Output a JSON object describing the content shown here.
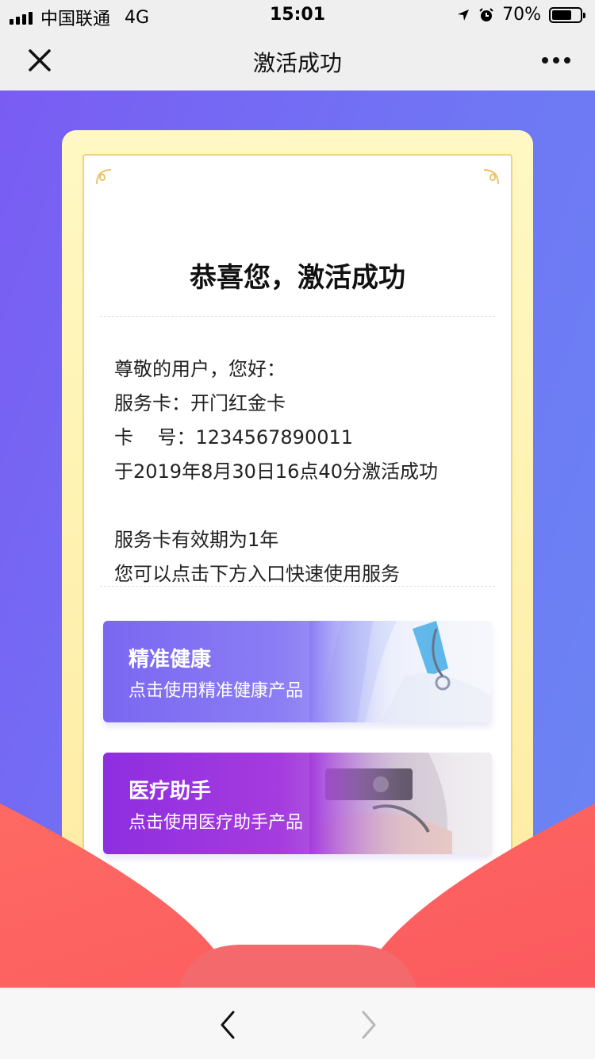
{
  "status_bar": {
    "carrier": "中国联通",
    "network": "4G",
    "time": "15:01",
    "battery": "70%"
  },
  "header": {
    "title": "激活成功"
  },
  "card": {
    "title": "恭喜您，激活成功",
    "greeting": "尊敬的用户，您好：",
    "service_card": "服务卡：开门红金卡",
    "card_number": "卡    号：1234567890011",
    "activated_at": "于2019年8月30日16点40分激活成功",
    "validity": "服务卡有效期为1年",
    "hint": "您可以点击下方入口快速使用服务"
  },
  "banners": [
    {
      "title": "精准健康",
      "subtitle": "点击使用精准健康产品"
    },
    {
      "title": "医疗助手",
      "subtitle": "点击使用医疗助手产品"
    }
  ],
  "colors": {
    "background_gradient_start": "#7a5cf3",
    "background_gradient_end": "#6a86f3",
    "envelope_red": "#fd5e5e",
    "card_gold": "#fff3b3"
  },
  "icons": {
    "close": "close-icon",
    "more": "more-icon",
    "back": "chevron-left-icon",
    "forward": "chevron-right-icon"
  }
}
